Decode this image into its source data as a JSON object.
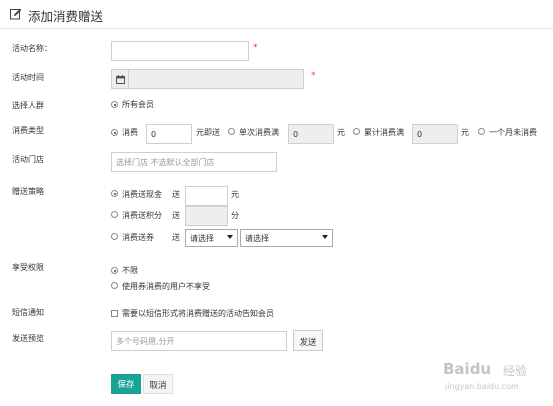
{
  "header": {
    "title": "添加消费赠送",
    "icon": "edit-icon"
  },
  "form": {
    "activity_name": {
      "label": "活动名称：",
      "value": "",
      "required_mark": "*"
    },
    "activity_time": {
      "label": "活动时间",
      "value": "",
      "required_mark": "*",
      "icon": "calendar-icon"
    },
    "target_group": {
      "label": "选择人群",
      "options": [
        {
          "label": "所有会员",
          "checked": true
        }
      ]
    },
    "consume_type": {
      "label": "消费类型",
      "opt_consume": {
        "label": "消费",
        "checked": true,
        "value": "0",
        "suffix": "元即送"
      },
      "opt_single": {
        "label": "单次消费满",
        "checked": false,
        "value": "0",
        "suffix": "元"
      },
      "opt_cumulative": {
        "label": "累计消费满",
        "checked": false,
        "value": "0",
        "suffix": "元"
      },
      "opt_month": {
        "label": "一个月未消费",
        "checked": false
      }
    },
    "store": {
      "label": "活动门店",
      "placeholder": "选择门店 不选默认全部门店"
    },
    "gift_strategy": {
      "label": "赠送策略",
      "cash": {
        "label": "消费送现金",
        "checked": true,
        "prefix": "送",
        "value": "",
        "suffix": "元"
      },
      "points": {
        "label": "消费送积分",
        "checked": false,
        "prefix": "送",
        "value": "",
        "suffix": "分"
      },
      "coupon": {
        "label": "消费送券",
        "checked": false,
        "prefix": "送",
        "select1": "请选择",
        "select2": "请选择"
      }
    },
    "rights": {
      "label": "享受权限",
      "opt_unlimited": {
        "label": "不限",
        "checked": true
      },
      "opt_coupon_users": {
        "label": "使用券消费的用户不享受",
        "checked": false
      }
    },
    "sms": {
      "label": "短信通知",
      "checkbox_label": "需要以短信形式将消费赠送的活动告知会员",
      "checked": false
    },
    "preview": {
      "label": "发送预览",
      "placeholder": "多个号码用,分开",
      "send_label": "发送"
    }
  },
  "actions": {
    "save_label": "保存",
    "cancel_label": "取消"
  },
  "watermark": {
    "brand": "Baidu",
    "brand_cn": "经验",
    "url": "jingyan.baidu.com"
  },
  "colors": {
    "accent": "#1aa394",
    "required": "#e4393c",
    "disabled_bg": "#eeeeee"
  }
}
